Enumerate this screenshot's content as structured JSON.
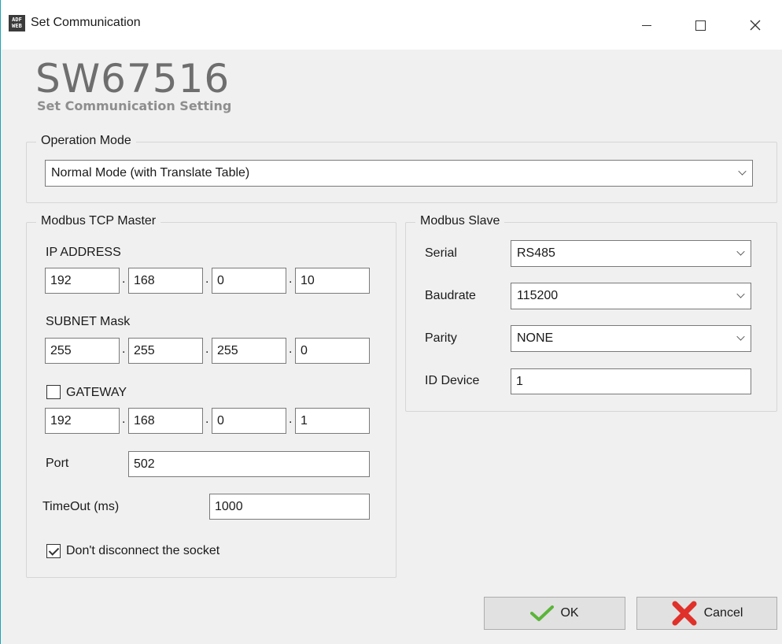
{
  "window": {
    "title": "Set Communication",
    "app_icon_text": "ADF WEB",
    "icons": {
      "app": "adfweb-logo-icon",
      "minimize": "minimize-icon",
      "maximize": "maximize-icon",
      "close": "close-icon"
    }
  },
  "header": {
    "title": "SW67516",
    "subtitle": "Set Communication Setting"
  },
  "operation_mode": {
    "group_label": "Operation Mode",
    "selected": "Normal Mode (with Translate Table)"
  },
  "master": {
    "group_label": "Modbus TCP Master",
    "ip_label": "IP ADDRESS",
    "ip": [
      "192",
      "168",
      "0",
      "10"
    ],
    "subnet_label": "SUBNET Mask",
    "subnet": [
      "255",
      "255",
      "255",
      "0"
    ],
    "gateway_label": "GATEWAY",
    "gateway_checked": false,
    "gateway": [
      "192",
      "168",
      "0",
      "1"
    ],
    "port_label": "Port",
    "port": "502",
    "timeout_label": "TimeOut (ms)",
    "timeout": "1000",
    "keep_socket_label": "Don't disconnect the socket",
    "keep_socket_checked": true
  },
  "slave": {
    "group_label": "Modbus Slave",
    "serial_label": "Serial",
    "serial": "RS485",
    "baudrate_label": "Baudrate",
    "baudrate": "115200",
    "parity_label": "Parity",
    "parity": "NONE",
    "id_label": "ID Device",
    "id": "1"
  },
  "buttons": {
    "ok_label": "OK",
    "cancel_label": "Cancel",
    "ok_icon": "checkmark-icon",
    "cancel_icon": "red-x-icon"
  },
  "colors": {
    "title_gray": "#6e6e6e",
    "ok_green": "#5bb53a",
    "cancel_red": "#e0302a",
    "window_border": "#1aa3ba"
  }
}
